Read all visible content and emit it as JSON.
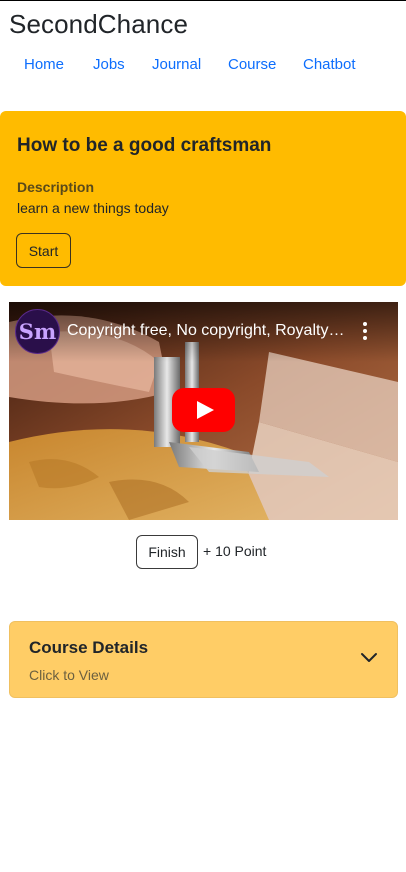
{
  "app": {
    "brand": "SecondChance"
  },
  "nav": {
    "items": [
      {
        "label": "Home"
      },
      {
        "label": "Jobs"
      },
      {
        "label": "Journal"
      },
      {
        "label": "Course"
      },
      {
        "label": "Chatbot"
      }
    ]
  },
  "course": {
    "title": "How to be a good craftsman",
    "description_label": "Description",
    "description": "learn a new things today",
    "start_label": "Start"
  },
  "video": {
    "channel_initials": "Sm",
    "title": "Copyright free, No copyright, Royalty free",
    "icons": [
      "channel-avatar",
      "more-vert-icon",
      "youtube-play-icon"
    ],
    "play_color": "#ff0000"
  },
  "finish": {
    "button_label": "Finish",
    "points_text": "+ 10 Point"
  },
  "details": {
    "title": "Course Details",
    "subtitle": "Click to View",
    "icon": "chevron-down-icon"
  },
  "colors": {
    "accent": "#ffbb00",
    "details_bg": "#ffcd66",
    "link": "#0d6efd"
  }
}
